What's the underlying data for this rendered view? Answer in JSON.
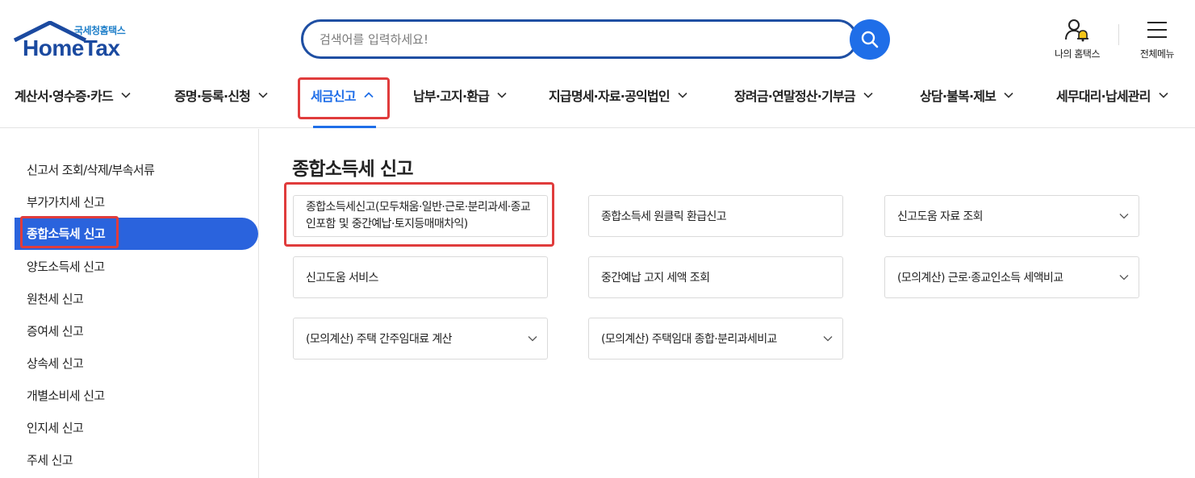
{
  "header": {
    "logo_sub": "국세청홈택스",
    "logo_main": "HomeTax",
    "search_placeholder": "검색어를 입력하세요!",
    "my_hometax_label": "나의 홈택스",
    "all_menu_label": "전체메뉴"
  },
  "gnb": {
    "items": [
      {
        "label": "계산서·영수증·카드",
        "active": false
      },
      {
        "label": "증명·등록·신청",
        "active": false
      },
      {
        "label": "세금신고",
        "active": true
      },
      {
        "label": "납부·고지·환급",
        "active": false
      },
      {
        "label": "지급명세·자료·공익법인",
        "active": false
      },
      {
        "label": "장려금·연말정산·기부금",
        "active": false
      },
      {
        "label": "상담·불복·제보",
        "active": false
      },
      {
        "label": "세무대리·납세관리",
        "active": false
      }
    ]
  },
  "sidebar": {
    "items": [
      {
        "label": "신고서 조회/삭제/부속서류",
        "active": false
      },
      {
        "label": "부가가치세 신고",
        "active": false
      },
      {
        "label": "종합소득세 신고",
        "active": true
      },
      {
        "label": "양도소득세 신고",
        "active": false
      },
      {
        "label": "원천세 신고",
        "active": false
      },
      {
        "label": "증여세 신고",
        "active": false
      },
      {
        "label": "상속세 신고",
        "active": false
      },
      {
        "label": "개별소비세 신고",
        "active": false
      },
      {
        "label": "인지세 신고",
        "active": false
      },
      {
        "label": "주세 신고",
        "active": false
      }
    ]
  },
  "content": {
    "title": "종합소득세 신고",
    "cards": [
      {
        "label": "종합소득세신고(모두채움·일반·근로·분리과세·종교인포함 및 중간예납·토지등매매차익)",
        "has_dropdown": false,
        "highlighted": true
      },
      {
        "label": "종합소득세 원클릭 환급신고",
        "has_dropdown": false,
        "highlighted": false
      },
      {
        "label": "신고도움 자료 조회",
        "has_dropdown": true,
        "highlighted": false
      },
      {
        "label": "신고도움 서비스",
        "has_dropdown": false,
        "highlighted": false
      },
      {
        "label": "중간예납 고지 세액 조회",
        "has_dropdown": false,
        "highlighted": false
      },
      {
        "label": "(모의계산) 근로·종교인소득 세액비교",
        "has_dropdown": true,
        "highlighted": false
      },
      {
        "label": "(모의계산) 주택 간주임대료 계산",
        "has_dropdown": true,
        "highlighted": false
      },
      {
        "label": "(모의계산) 주택임대 종합·분리과세비교",
        "has_dropdown": true,
        "highlighted": false
      }
    ]
  },
  "colors": {
    "brand_blue": "#1f4fa3",
    "accent_blue": "#1f6ee8",
    "active_bg": "#2a63dd",
    "highlight_red": "#e03c3c",
    "bell_yellow": "#f5c518"
  }
}
